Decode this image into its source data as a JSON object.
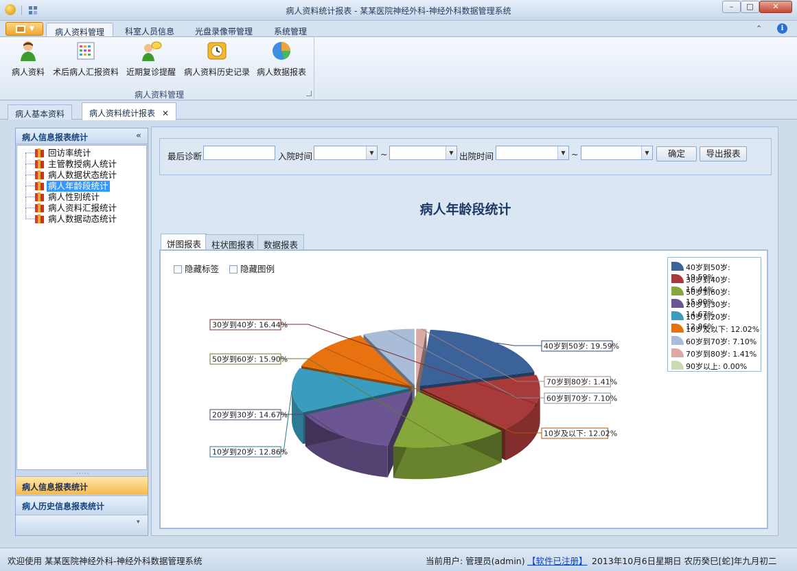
{
  "window": {
    "title": "病人资料统计报表 - 某某医院神经外科-神经外科数据管理系统",
    "min": "–",
    "max": "□",
    "close": "✕"
  },
  "ribbon": {
    "tabs": [
      "病人资料管理",
      "科室人员信息",
      "光盘录像带管理",
      "系统管理"
    ],
    "buttons": [
      "病人资料",
      "术后病人汇报资料",
      "近期复诊提醒",
      "病人资料历史记录",
      "病人数据报表"
    ],
    "group_label": "病人资料管理",
    "up": "⌃",
    "info": "i"
  },
  "doc_tabs": [
    "病人基本资料",
    "病人资料统计报表"
  ],
  "doc_tab_close": "✕",
  "left_panel": {
    "header": "病人信息报表统计",
    "collapse": "«",
    "tree": [
      "回访率统计",
      "主管教授病人统计",
      "病人数据状态统计",
      "病人年龄段统计",
      "病人性别统计",
      "病人资料汇报统计",
      "病人数据动态统计"
    ],
    "grip": "·····",
    "bars": [
      "病人信息报表统计",
      "病人历史信息报表统计"
    ],
    "more": "▾"
  },
  "filter": {
    "last_diag": "最后诊断",
    "admit": "入院时间",
    "discharge": "出院时间",
    "tilde": "~",
    "confirm": "确定",
    "export": "导出报表",
    "dd": "▼"
  },
  "report_title": "病人年龄段统计",
  "chart_tabs": [
    "饼图报表",
    "柱状图报表",
    "数据报表"
  ],
  "checkboxes": [
    "隐藏标签",
    "隐藏图例"
  ],
  "colors": {
    "40-50": "#3b6299",
    "30-40": "#a83a39",
    "50-60": "#86a73a",
    "20-30": "#6c5593",
    "10-20": "#3a9cbf",
    "under10": "#e8720f",
    "60-70": "#a9bcd8",
    "70-80": "#dba9a6",
    "90plus": "#c9dcb1"
  },
  "chart_data": {
    "type": "pie",
    "categories": [
      "40岁到50岁",
      "30岁到40岁",
      "50岁到60岁",
      "20岁到30岁",
      "10岁到20岁",
      "10岁及以下",
      "60岁到70岁",
      "70岁到80岁",
      "90岁以上"
    ],
    "values": [
      19.59,
      16.44,
      15.9,
      14.67,
      12.86,
      12.02,
      7.1,
      1.41,
      0.0
    ],
    "labels": [
      "40岁到50岁: 19.59%",
      "30岁到40岁: 16.44%",
      "50岁到60岁: 15.90%",
      "20岁到30岁: 14.67%",
      "10岁到20岁: 12.86%",
      "10岁及以下: 12.02%",
      "60岁到70岁: 7.10%",
      "70岁到80岁: 1.41%",
      "90岁以上: 0.00%"
    ],
    "legend_position": "top-right",
    "pie_3d": true
  },
  "status": {
    "welcome": "欢迎使用 某某医院神经外科-神经外科数据管理系统",
    "user": "当前用户: 管理员(admin)",
    "registered": "【软件已注册】",
    "date": "2013年10月6日星期日 农历癸巳[蛇]年九月初二"
  }
}
